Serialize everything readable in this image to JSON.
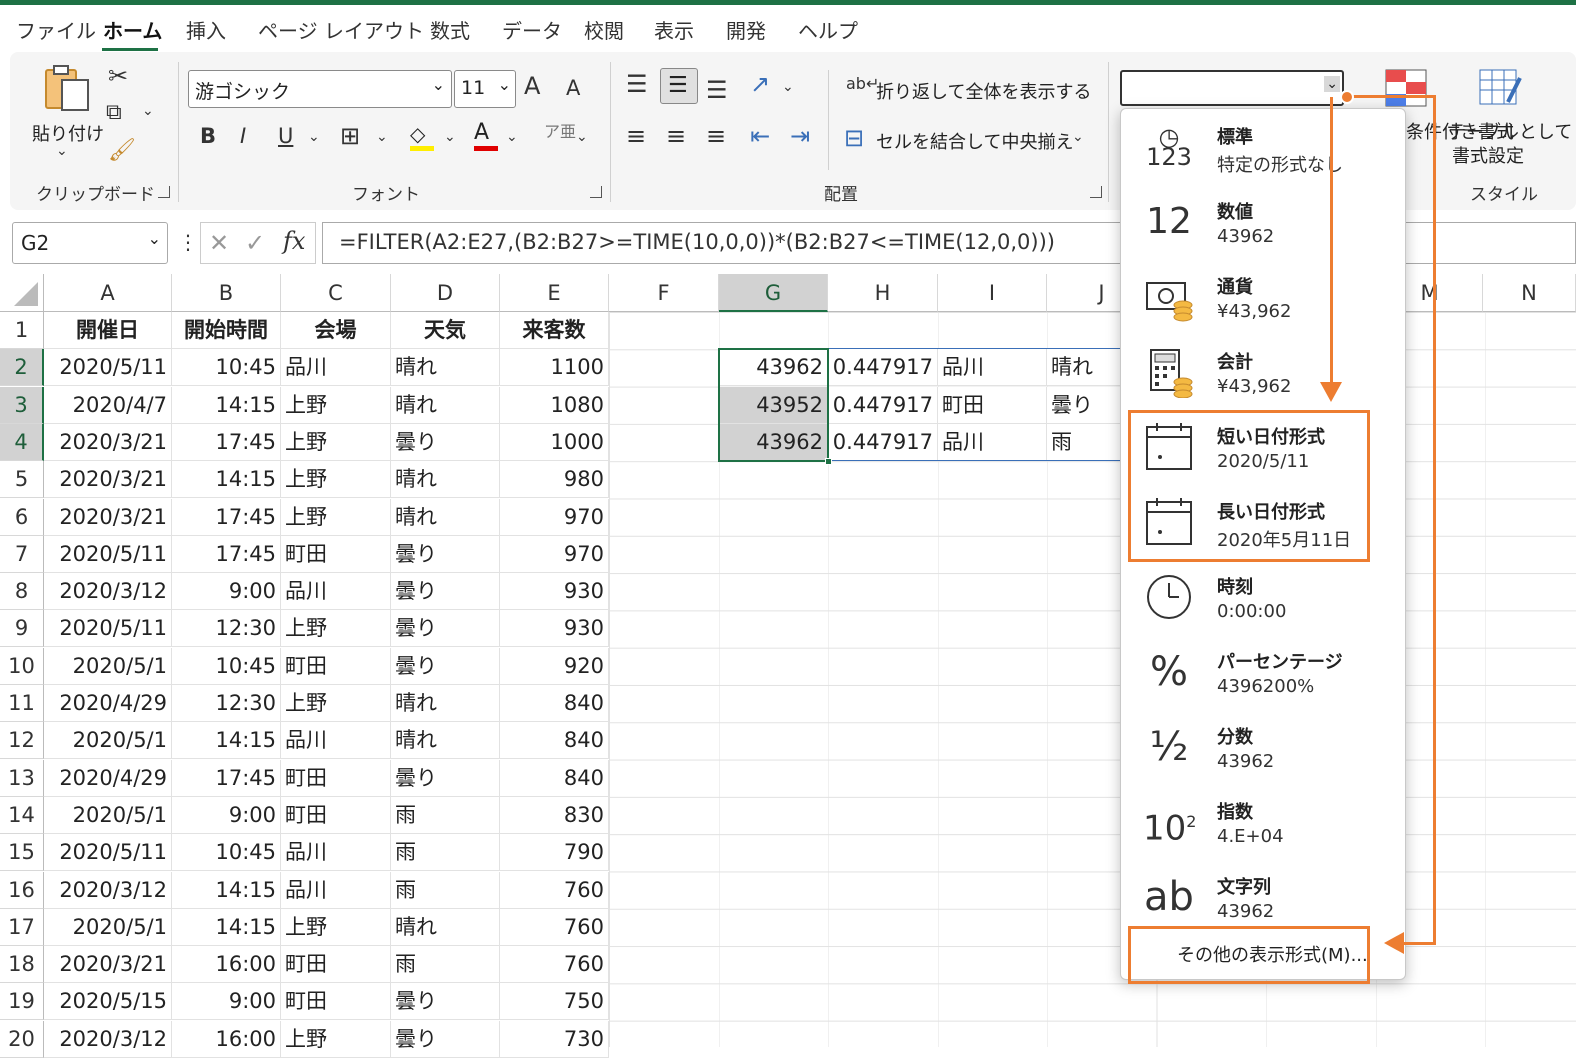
{
  "tabs": [
    "ファイル",
    "ホーム",
    "挿入",
    "ページ レイアウト",
    "数式",
    "データ",
    "校閲",
    "表示",
    "開発",
    "ヘルプ"
  ],
  "ribbon": {
    "clipboard": {
      "paste_label": "貼り付け",
      "group_label": "クリップボード"
    },
    "font": {
      "font_name": "游ゴシック",
      "font_size": "11",
      "group_label": "フォント",
      "bold": "B",
      "italic": "I",
      "underline": "U",
      "grow": "A",
      "shrink": "A",
      "font_color": "A"
    },
    "alignment": {
      "wrap_label": "折り返して全体を表示する",
      "merge_label": "セルを結合して中央揃え",
      "group_label": "配置"
    },
    "number": {
      "format_value": ""
    },
    "styles": {
      "cond_format_label": "条件付き書式",
      "table_label1": "テーブルとして",
      "table_label2": "書式設定",
      "group_label": "スタイル"
    }
  },
  "formula_bar": {
    "name_box": "G2",
    "fx": "fx",
    "formula": "=FILTER(A2:E27,(B2:B27>=TIME(10,0,0))*(B2:B27<=TIME(12,0,0)))"
  },
  "columns": [
    "A",
    "B",
    "C",
    "D",
    "E",
    "F",
    "G",
    "H",
    "I",
    "J",
    "M",
    "N"
  ],
  "row_numbers": [
    "1",
    "2",
    "3",
    "4",
    "5",
    "6",
    "7",
    "8",
    "9",
    "10",
    "11",
    "12",
    "13",
    "14",
    "15",
    "16",
    "17",
    "18",
    "19",
    "20"
  ],
  "headers": [
    "開催日",
    "開始時間",
    "会場",
    "天気",
    "来客数"
  ],
  "rows": [
    [
      "2020/5/11",
      "10:45",
      "品川",
      "晴れ",
      "1100"
    ],
    [
      "2020/4/7",
      "14:15",
      "上野",
      "晴れ",
      "1080"
    ],
    [
      "2020/3/21",
      "17:45",
      "上野",
      "曇り",
      "1000"
    ],
    [
      "2020/3/21",
      "14:15",
      "上野",
      "晴れ",
      "980"
    ],
    [
      "2020/3/21",
      "17:45",
      "上野",
      "晴れ",
      "970"
    ],
    [
      "2020/5/11",
      "17:45",
      "町田",
      "曇り",
      "970"
    ],
    [
      "2020/3/12",
      "9:00",
      "品川",
      "曇り",
      "930"
    ],
    [
      "2020/5/11",
      "12:30",
      "上野",
      "曇り",
      "930"
    ],
    [
      "2020/5/1",
      "10:45",
      "町田",
      "曇り",
      "920"
    ],
    [
      "2020/4/29",
      "12:30",
      "上野",
      "晴れ",
      "840"
    ],
    [
      "2020/5/1",
      "14:15",
      "品川",
      "晴れ",
      "840"
    ],
    [
      "2020/4/29",
      "17:45",
      "町田",
      "曇り",
      "840"
    ],
    [
      "2020/5/1",
      "9:00",
      "町田",
      "雨",
      "830"
    ],
    [
      "2020/5/11",
      "10:45",
      "品川",
      "雨",
      "790"
    ],
    [
      "2020/3/12",
      "14:15",
      "品川",
      "雨",
      "760"
    ],
    [
      "2020/5/1",
      "14:15",
      "上野",
      "晴れ",
      "760"
    ],
    [
      "2020/3/21",
      "16:00",
      "町田",
      "雨",
      "760"
    ],
    [
      "2020/5/15",
      "9:00",
      "町田",
      "曇り",
      "750"
    ],
    [
      "2020/3/12",
      "16:00",
      "上野",
      "曇り",
      "730"
    ]
  ],
  "filter_result": [
    [
      "43962",
      "0.447917",
      "品川",
      "晴れ"
    ],
    [
      "43952",
      "0.447917",
      "町田",
      "曇り"
    ],
    [
      "43962",
      "0.447917",
      "品川",
      "雨"
    ]
  ],
  "format_menu": {
    "items": [
      {
        "name": "標準",
        "sample": "特定の形式なし",
        "icon": "clock-123-icon"
      },
      {
        "name": "数値",
        "sample": "43962",
        "icon": "number-12-icon"
      },
      {
        "name": "通貨",
        "sample": "¥43,962",
        "icon": "currency-icon"
      },
      {
        "name": "会計",
        "sample": " ¥43,962",
        "icon": "accounting-icon"
      },
      {
        "name": "短い日付形式",
        "sample": "2020/5/11",
        "icon": "calendar-icon"
      },
      {
        "name": "長い日付形式",
        "sample": "2020年5月11日",
        "icon": "calendar-icon"
      },
      {
        "name": "時刻",
        "sample": "0:00:00",
        "icon": "clock-icon"
      },
      {
        "name": "パーセンテージ",
        "sample": "4396200%",
        "icon": "percent-icon"
      },
      {
        "name": "分数",
        "sample": "43962",
        "icon": "fraction-icon"
      },
      {
        "name": "指数",
        "sample": "4.E+04",
        "icon": "exponent-icon"
      },
      {
        "name": "文字列",
        "sample": "43962",
        "icon": "text-ab-icon"
      }
    ],
    "more_label": "その他の表示形式(M)..."
  },
  "colors": {
    "accent": "#1e7145",
    "highlight": "#ed7d31",
    "selected_header": "#d2d2d2"
  }
}
